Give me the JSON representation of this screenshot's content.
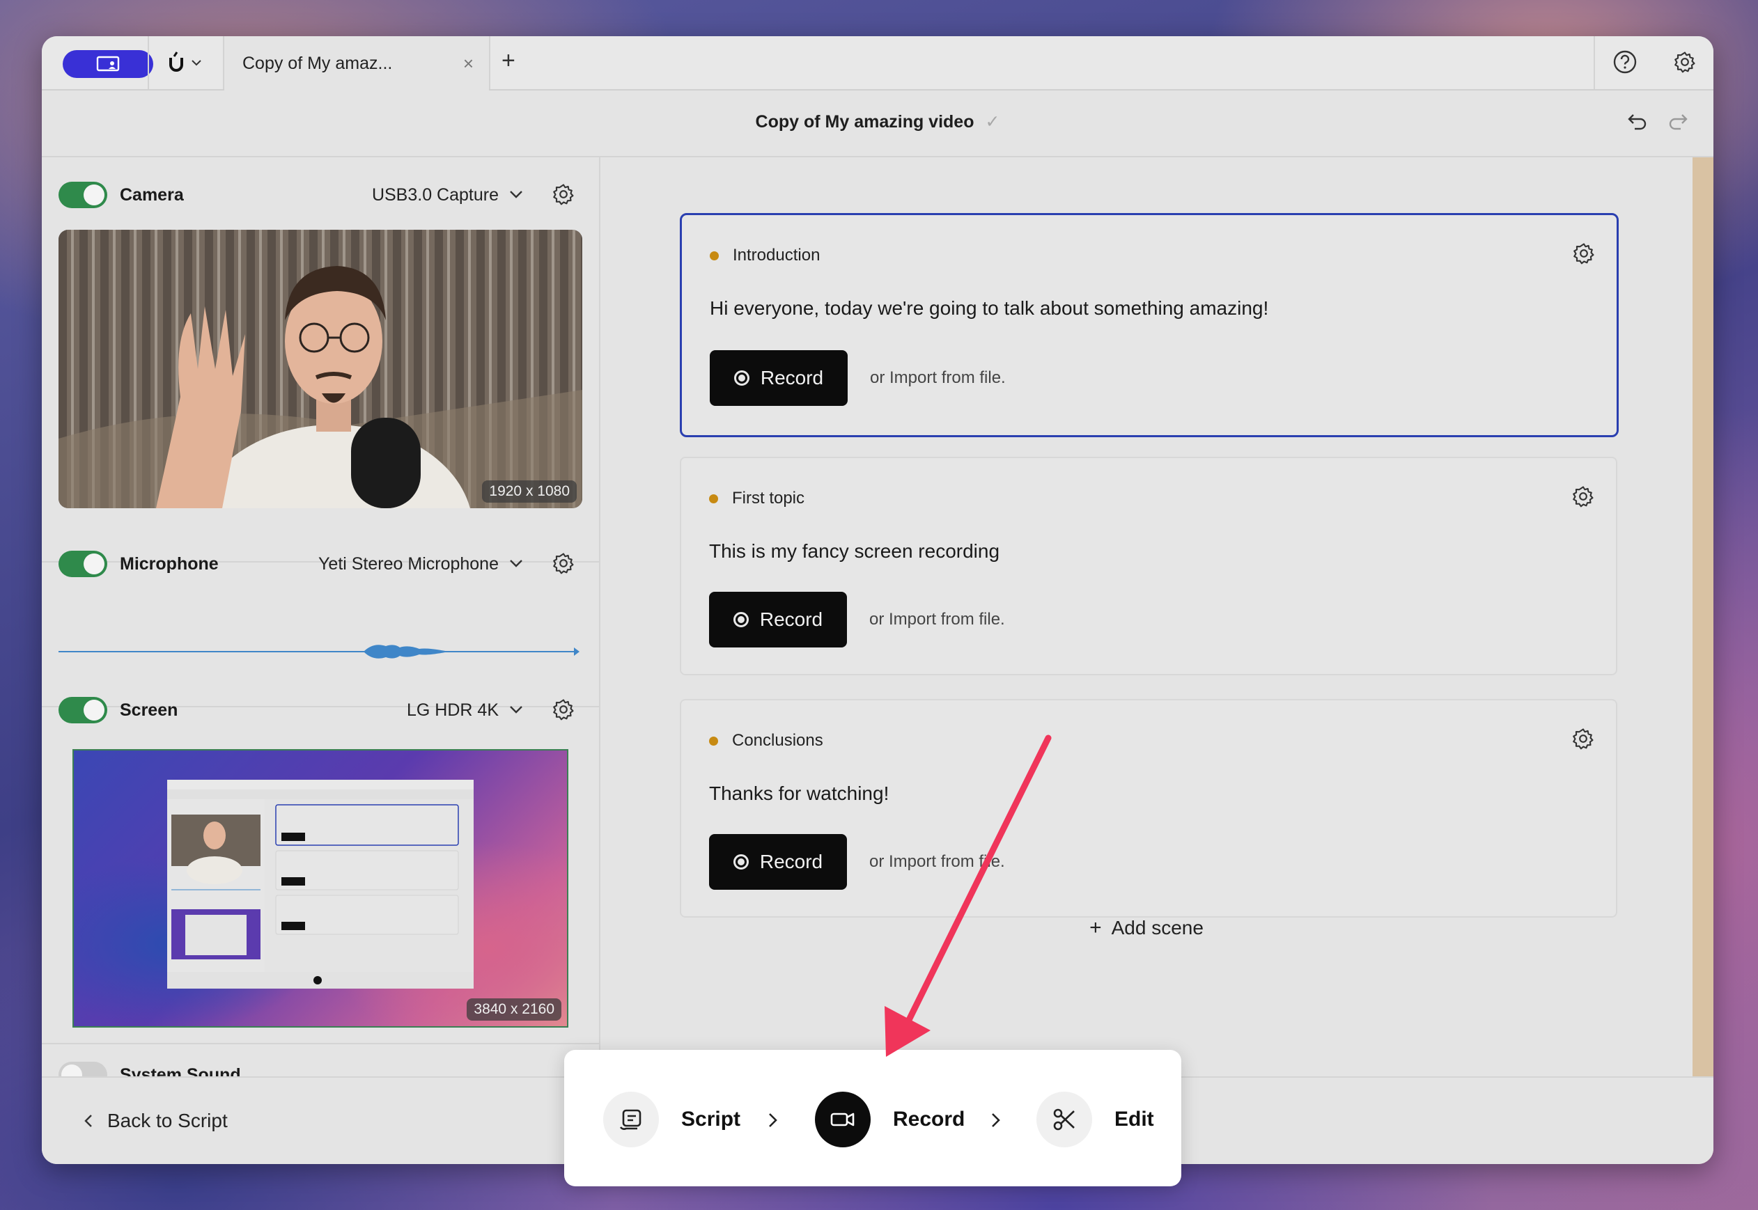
{
  "tab": {
    "title": "Copy of My amaz...",
    "close": "×",
    "new": "+"
  },
  "header": {
    "doc_title": "Copy of My amazing video",
    "saved_mark": "✓"
  },
  "sources": {
    "camera": {
      "label": "Camera",
      "device": "USB3.0 Capture",
      "enabled": true,
      "resolution": "1920 x 1080"
    },
    "microphone": {
      "label": "Microphone",
      "device": "Yeti Stereo Microphone",
      "enabled": true
    },
    "screen": {
      "label": "Screen",
      "device": "LG HDR 4K",
      "enabled": true,
      "resolution": "3840 x 2160"
    },
    "system_sound": {
      "label": "System Sound",
      "enabled": false
    }
  },
  "scenes": [
    {
      "title": "Introduction",
      "text": "Hi everyone, today we're going to talk about something amazing!",
      "record_label": "Record",
      "import_label": "or Import from file."
    },
    {
      "title": "First topic",
      "text": "This is my fancy screen recording",
      "record_label": "Record",
      "import_label": "or Import from file."
    },
    {
      "title": "Conclusions",
      "text": "Thanks for watching!",
      "record_label": "Record",
      "import_label": "or Import from file."
    }
  ],
  "add_scene_label": "Add scene",
  "footer": {
    "back_label": "Back to Script"
  },
  "steps": {
    "script": "Script",
    "record": "Record",
    "edit": "Edit",
    "active": "record"
  },
  "colors": {
    "accent": "#3930d6",
    "toggle_on": "#2f8a4b",
    "selection": "#2a3fb0",
    "scene_dot": "#c78a12",
    "arrow": "#f0355a"
  },
  "icons": [
    "screen-mode-icon",
    "help-icon",
    "gear-icon",
    "undo-icon",
    "redo-icon",
    "chevron-down-icon",
    "script-icon",
    "camera-icon",
    "scissors-icon",
    "chevron-right-icon",
    "chevron-left-icon",
    "plus-icon"
  ]
}
